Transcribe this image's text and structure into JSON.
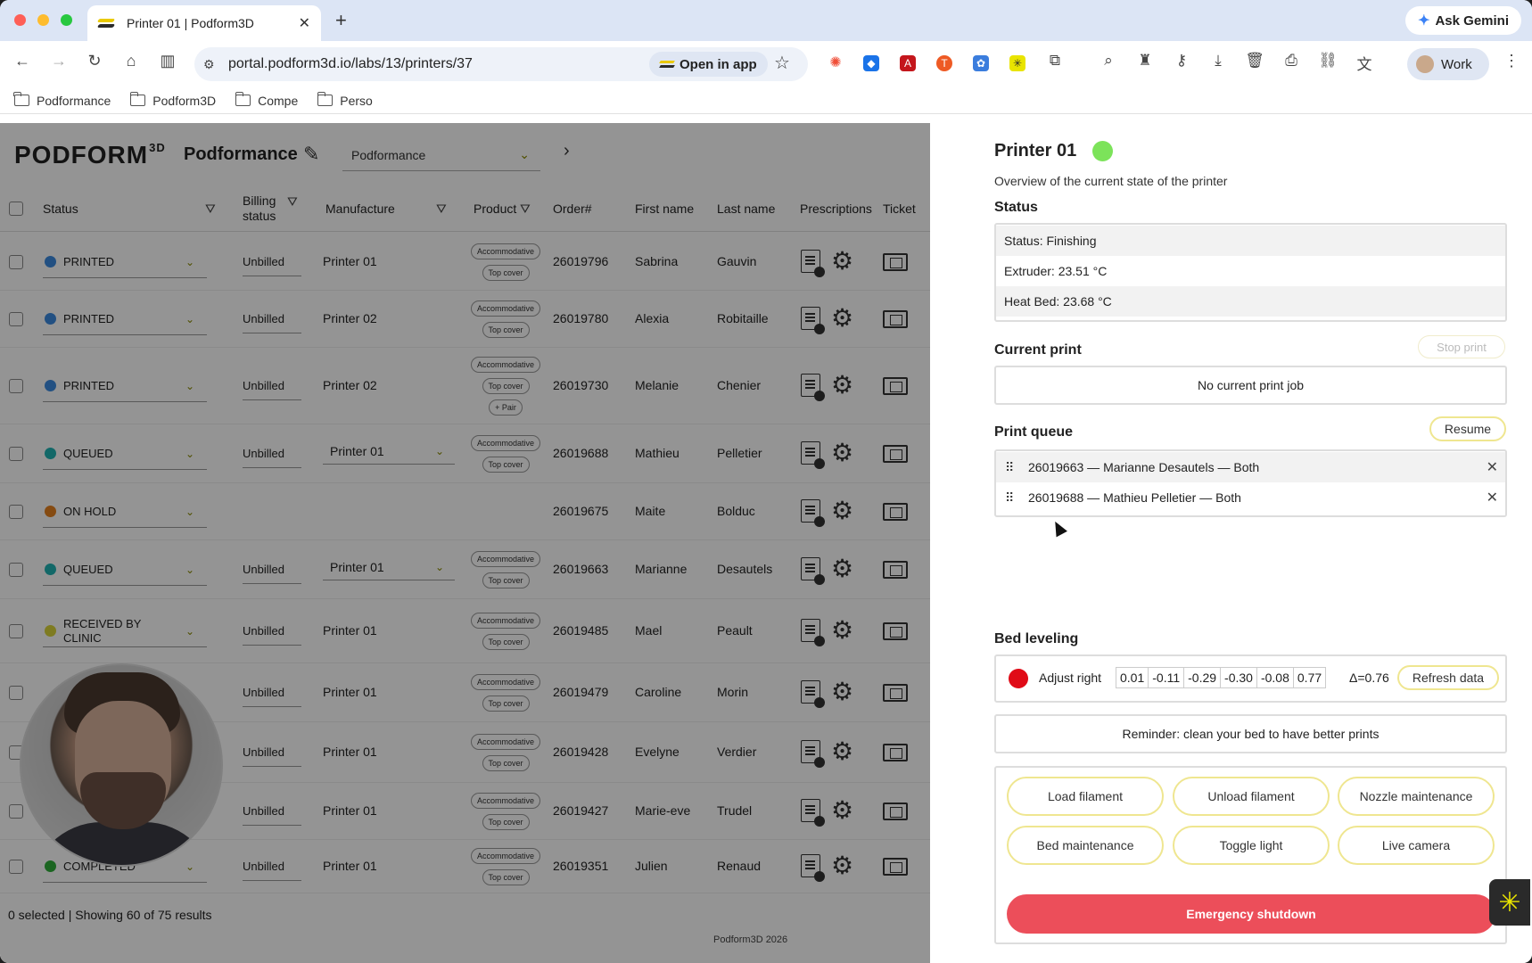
{
  "browser": {
    "tab_title": "Printer 01 | Podform3D",
    "url": "portal.podform3d.io/labs/13/printers/37",
    "open_in_app": "Open in app",
    "ask_gemini": "Ask Gemini",
    "profile": "Work",
    "bookmarks": [
      "Podformance",
      "Podform3D",
      "Compe",
      "Perso"
    ]
  },
  "app": {
    "logo": "PODFORM",
    "logo_sup": "3D",
    "org_name": "Podformance",
    "org_select": "Podformance",
    "columns": {
      "status": "Status",
      "billing": "Billing status",
      "manufacture": "Manufacture",
      "product": "Product",
      "order": "Order#",
      "first": "First name",
      "last": "Last name",
      "prescriptions": "Prescriptions",
      "ticket": "Ticket"
    },
    "rows": [
      {
        "status": "PRINTED",
        "color": "#3b8be0",
        "billing": "Unbilled",
        "manufacture": "Printer 01",
        "select": false,
        "chips": [
          "Accommodative",
          "Top cover"
        ],
        "order": "26019796",
        "first": "Sabrina",
        "last": "Gauvin"
      },
      {
        "status": "PRINTED",
        "color": "#3b8be0",
        "billing": "Unbilled",
        "manufacture": "Printer 02",
        "select": false,
        "chips": [
          "Accommodative",
          "Top cover"
        ],
        "order": "26019780",
        "first": "Alexia",
        "last": "Robitaille"
      },
      {
        "status": "PRINTED",
        "color": "#3b8be0",
        "billing": "Unbilled",
        "manufacture": "Printer 02",
        "select": false,
        "chips": [
          "Accommodative",
          "Top cover",
          "+ Pair"
        ],
        "order": "26019730",
        "first": "Melanie",
        "last": "Chenier"
      },
      {
        "status": "QUEUED",
        "color": "#1fb3b3",
        "billing": "Unbilled",
        "manufacture": "Printer 01",
        "select": true,
        "chips": [
          "Accommodative",
          "Top cover"
        ],
        "order": "26019688",
        "first": "Mathieu",
        "last": "Pelletier"
      },
      {
        "status": "ON HOLD",
        "color": "#e5821f",
        "billing": "",
        "manufacture": "",
        "select": false,
        "chips": [],
        "order": "26019675",
        "first": "Maite",
        "last": "Bolduc"
      },
      {
        "status": "QUEUED",
        "color": "#1fb3b3",
        "billing": "Unbilled",
        "manufacture": "Printer 01",
        "select": true,
        "chips": [
          "Accommodative",
          "Top cover"
        ],
        "order": "26019663",
        "first": "Marianne",
        "last": "Desautels"
      },
      {
        "status": "RECEIVED BY CLINIC",
        "color": "#d9d43a",
        "billing": "Unbilled",
        "manufacture": "Printer 01",
        "select": false,
        "chips": [
          "Accommodative",
          "Top cover"
        ],
        "order": "26019485",
        "first": "Mael",
        "last": "Peault"
      },
      {
        "status": "",
        "color": "",
        "billing": "Unbilled",
        "manufacture": "Printer 01",
        "select": false,
        "chips": [
          "Accommodative",
          "Top cover"
        ],
        "order": "26019479",
        "first": "Caroline",
        "last": "Morin"
      },
      {
        "status": "",
        "color": "",
        "billing": "Unbilled",
        "manufacture": "Printer 01",
        "select": false,
        "chips": [
          "Accommodative",
          "Top cover"
        ],
        "order": "26019428",
        "first": "Evelyne",
        "last": "Verdier"
      },
      {
        "status": "",
        "color": "",
        "billing": "Unbilled",
        "manufacture": "Printer 01",
        "select": false,
        "chips": [
          "Accommodative",
          "Top cover"
        ],
        "order": "26019427",
        "first": "Marie-eve",
        "last": "Trudel"
      },
      {
        "status": "COMPLETED",
        "color": "#2fae3a",
        "billing": "Unbilled",
        "manufacture": "Printer 01",
        "select": false,
        "chips": [
          "Accommodative",
          "Top cover"
        ],
        "order": "26019351",
        "first": "Julien",
        "last": "Renaud"
      }
    ],
    "footer_count": "0 selected | Showing 60 of 75 results",
    "footer_copyright": "Podform3D 2026"
  },
  "panel": {
    "title": "Printer 01",
    "subtitle": "Overview of the current state of the printer",
    "status_heading": "Status",
    "status_lines": [
      "Status: Finishing",
      "Extruder: 23.51 °C",
      "Heat Bed: 23.68 °C"
    ],
    "current_print_heading": "Current print",
    "stop_print": "Stop print",
    "no_print": "No current print job",
    "queue_heading": "Print queue",
    "resume": "Resume",
    "queue": [
      "26019663 — Marianne Desautels — Both",
      "26019688 — Mathieu Pelletier — Both"
    ],
    "bed_heading": "Bed leveling",
    "adjust": "Adjust right",
    "bed_values": [
      "0.01",
      "-0.11",
      "-0.29",
      "-0.30",
      "-0.08",
      "0.77"
    ],
    "delta": "Δ=0.76",
    "refresh": "Refresh data",
    "reminder": "Reminder: clean your bed to have better prints",
    "actions": [
      "Load filament",
      "Unload filament",
      "Nozzle maintenance",
      "Bed maintenance",
      "Toggle light",
      "Live camera"
    ],
    "emergency": "Emergency shutdown"
  }
}
